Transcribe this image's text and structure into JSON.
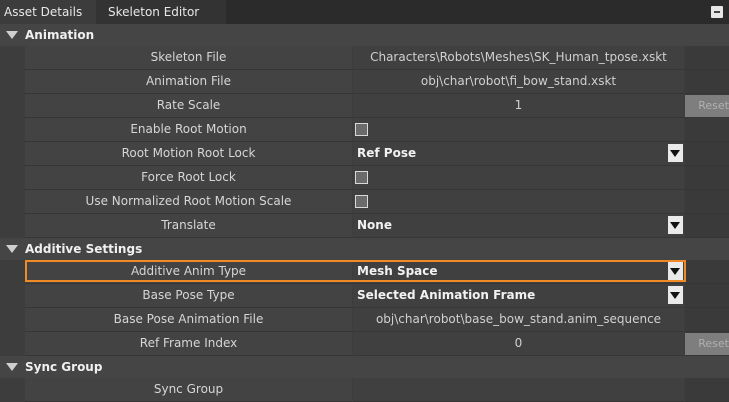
{
  "tabs": [
    {
      "label": "Asset Details"
    },
    {
      "label": "Skeleton Editor"
    }
  ],
  "sections": {
    "animation": {
      "title": "Animation",
      "rows": [
        {
          "label": "Skeleton File",
          "value": "Characters\\Robots\\Meshes\\SK_Human_tpose.xskt"
        },
        {
          "label": "Animation File",
          "value": "obj\\char\\robot\\fi_bow_stand.xskt"
        },
        {
          "label": "Rate Scale",
          "value": "1",
          "reset": "Reset"
        },
        {
          "label": "Enable Root Motion",
          "checked": false
        },
        {
          "label": "Root Motion Root Lock",
          "value": "Ref Pose"
        },
        {
          "label": "Force Root Lock",
          "checked": false
        },
        {
          "label": "Use Normalized Root Motion Scale",
          "checked": false
        },
        {
          "label": "Translate",
          "value": "None"
        }
      ]
    },
    "additive": {
      "title": "Additive Settings",
      "rows": [
        {
          "label": "Additive Anim Type",
          "value": "Mesh Space"
        },
        {
          "label": "Base Pose Type",
          "value": "Selected Animation Frame"
        },
        {
          "label": "Base Pose Animation File",
          "value": "obj\\char\\robot\\base_bow_stand.anim_sequence"
        },
        {
          "label": "Ref Frame Index",
          "value": "0",
          "reset": "Reset"
        }
      ]
    },
    "sync": {
      "title": "Sync Group",
      "rows": [
        {
          "label": "Sync Group",
          "value": ""
        }
      ]
    }
  },
  "colors": {
    "highlight": "#f08a24",
    "panel": "#3d3d3d"
  }
}
